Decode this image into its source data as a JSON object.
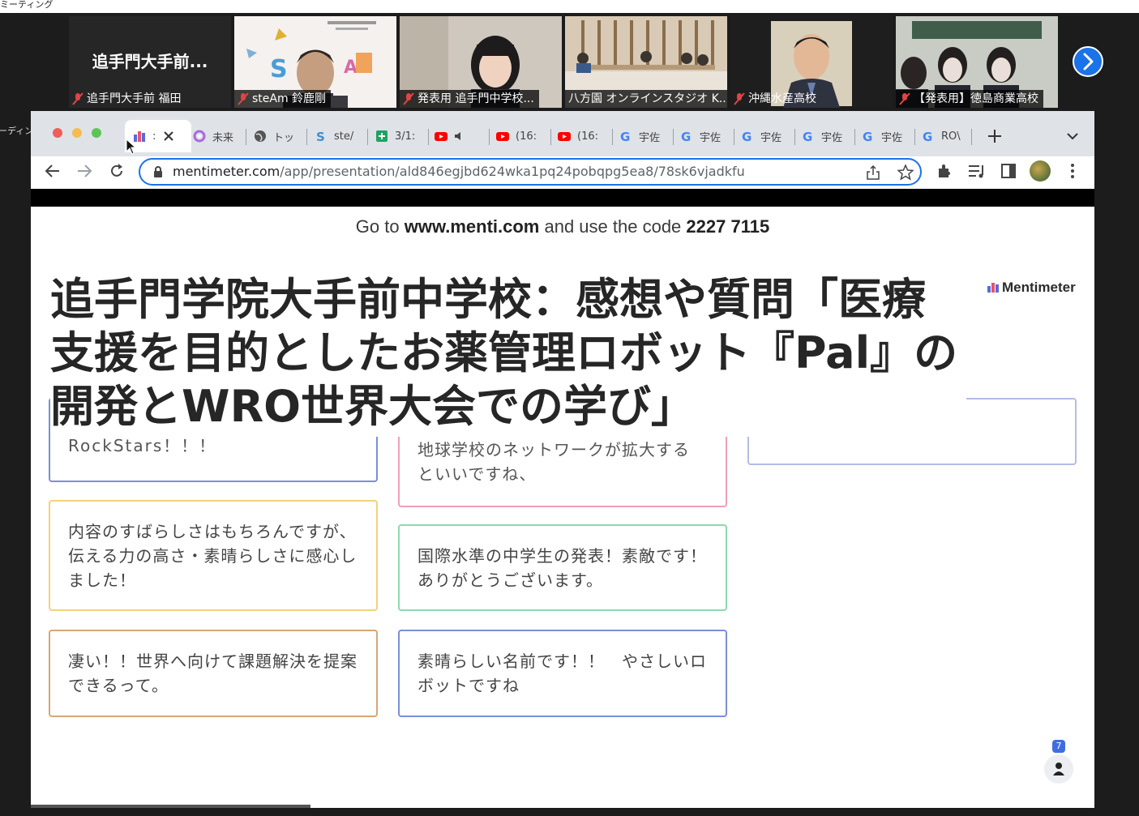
{
  "zoom_window": {
    "title_fragment": "ミーティング",
    "recording_fragment": "ーディング"
  },
  "gallery": [
    {
      "big_label": "追手門大手前...",
      "name": "追手門大手前 福田",
      "muted": true
    },
    {
      "name": "steAm 鈴鹿剛",
      "muted": true
    },
    {
      "name": "発表用 追手門中学校...",
      "muted": true
    },
    {
      "name": "八方園 オンラインスタジオ K...",
      "muted": false
    },
    {
      "name": "沖縄水産高校",
      "muted": true
    },
    {
      "name": "【発表用】徳島商業高校",
      "muted": true
    }
  ],
  "browser": {
    "tabs": [
      {
        "label": ":",
        "icon": "mentimeter-icon",
        "active": true
      },
      {
        "label": "未来",
        "icon": "flower-icon"
      },
      {
        "label": "トッ",
        "icon": "globe-icon"
      },
      {
        "label": "ste/",
        "icon": "steam-s-icon"
      },
      {
        "label": "3/1:",
        "icon": "sheets-icon"
      },
      {
        "label": "",
        "icon": "youtube-icon"
      },
      {
        "label": "(16:",
        "icon": "youtube-icon"
      },
      {
        "label": "(16:",
        "icon": "youtube-icon"
      },
      {
        "label": "宇佐",
        "icon": "google-icon"
      },
      {
        "label": "宇佐",
        "icon": "google-icon"
      },
      {
        "label": "宇佐",
        "icon": "google-icon"
      },
      {
        "label": "宇佐",
        "icon": "google-icon"
      },
      {
        "label": "宇佐",
        "icon": "google-icon"
      },
      {
        "label": "RO\\",
        "icon": "google-icon"
      }
    ],
    "url_domain": "mentimeter.com",
    "url_path": "/app/presentation/ald846egjbd624wka1pq24pobqpg5ea8/78sk6vjadkfu"
  },
  "menti": {
    "code_prefix": "Go to ",
    "code_site": "www.menti.com",
    "code_middle": " and use the code ",
    "code": "2227 7115",
    "brand": "Mentimeter",
    "question": "追手門学院大手前中学校：感想や質問「医療支援を目的としたお薬管理ロボット『Pal』の開発とWRO世界大会での学び」",
    "partial_1": "RockStars！！！",
    "partial_2_top": "地球学校のネットワークが拡大する",
    "partial_2": "といいですね、",
    "responses": [
      {
        "text": "内容のすばらしさはもちろんですが、伝える力の高さ・素晴らしさに感心しました！",
        "color": "#f1d37a"
      },
      {
        "text": "国際水準の中学生の発表！素敵です！ありがとうございます。",
        "color": "#8fd8b0"
      },
      {
        "text": "凄い！！世界へ向けて課題解決を提案できるって。",
        "color": "#d4a877"
      },
      {
        "text": "素晴らしい名前です！！　やさしいロボットですね",
        "color": "#7a8fd6"
      }
    ],
    "participants": "7"
  }
}
